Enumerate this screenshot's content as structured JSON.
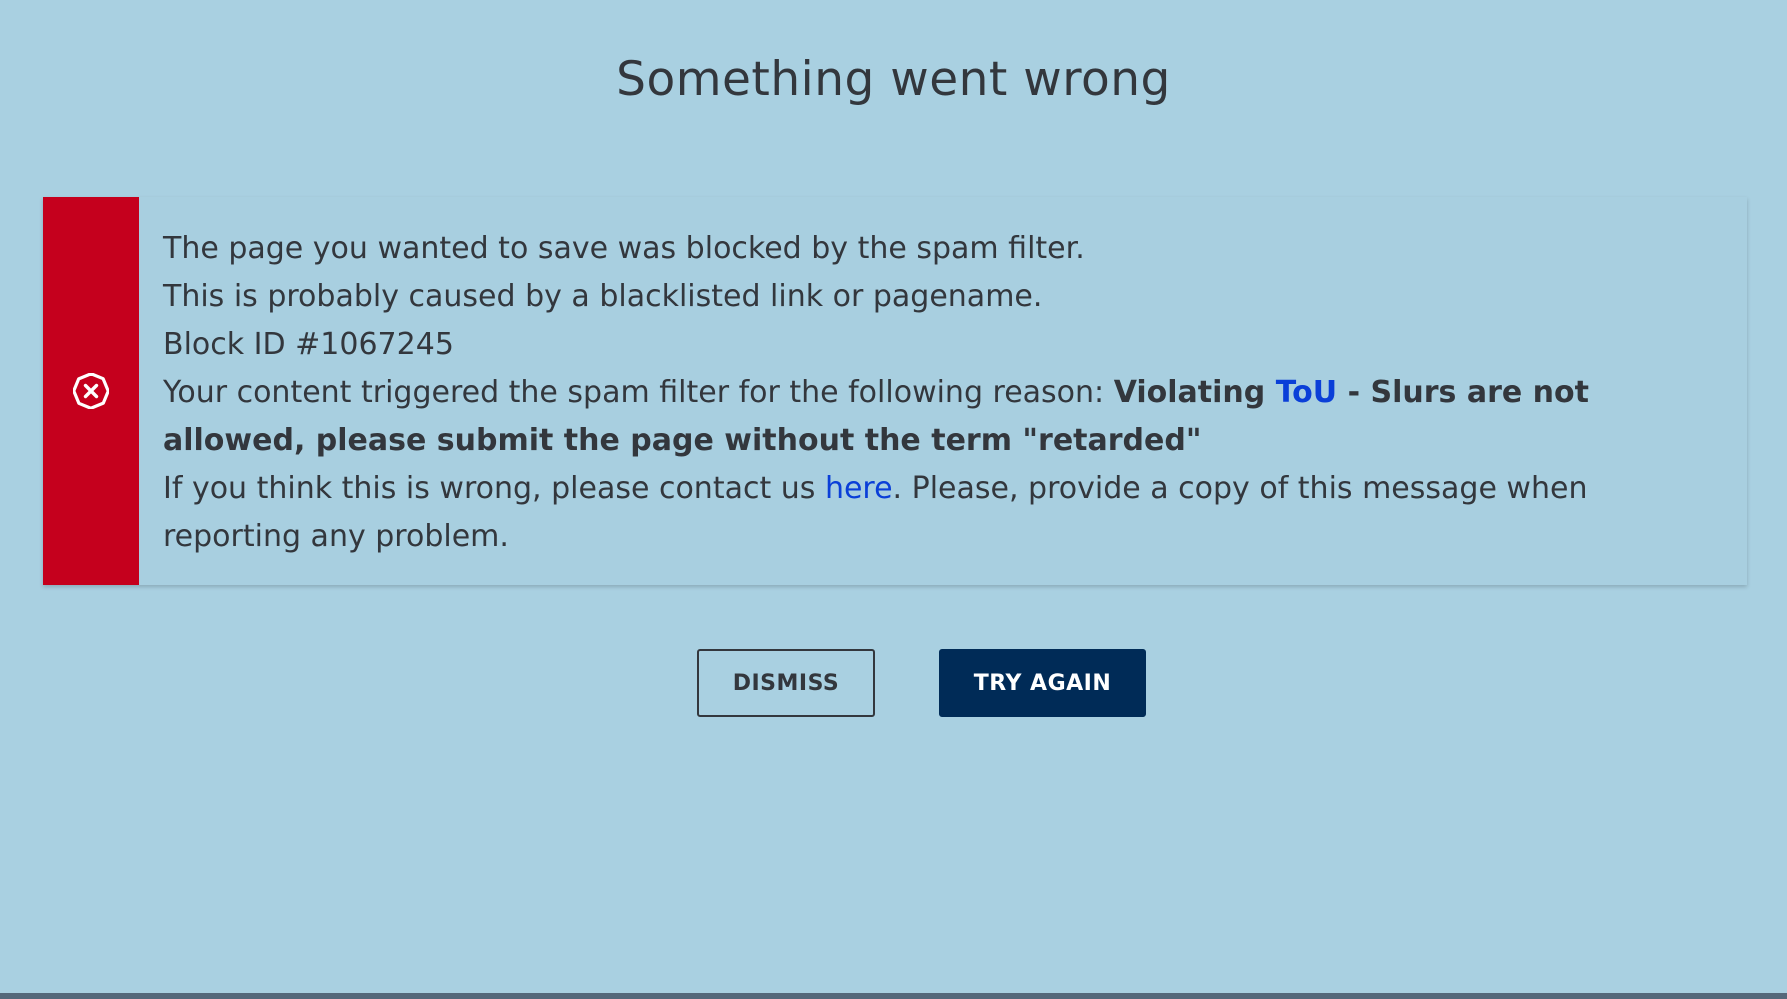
{
  "page": {
    "title": "Something went wrong"
  },
  "error": {
    "icon": "close-circle-icon",
    "accent_color": "#c5001d",
    "line1": "The page you wanted to save was blocked by the spam filter.",
    "line2": "This is probably caused by a blacklisted link or pagename.",
    "block_id": "Block ID #1067245",
    "reason_intro": "Your content triggered the spam filter for the following reason: ",
    "reason_bold_pre": "Violating ",
    "reason_link": "ToU",
    "reason_bold_post": " - Slurs are not allowed, please submit the page without the term \"retarded\"",
    "contact_pre": "If you think this is wrong, please contact us ",
    "contact_link": "here",
    "contact_post": ". Please, provide a copy of this message when reporting any problem."
  },
  "buttons": {
    "dismiss": "DISMISS",
    "try_again": "TRY AGAIN",
    "primary_color": "#002b57"
  }
}
